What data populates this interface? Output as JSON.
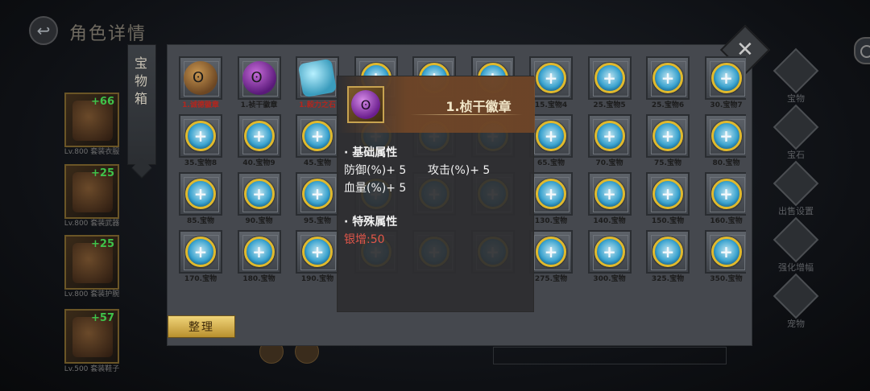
{
  "header": {
    "title": "角色详情"
  },
  "equipment": [
    {
      "plus": "+66",
      "caption": "Lv.800 套装衣服"
    },
    {
      "plus": "+25",
      "caption": "Lv.800 套装武器"
    },
    {
      "plus": "+25",
      "caption": "Lv.800 套装护腕"
    },
    {
      "plus": "+57",
      "caption": "Lv.500 套装鞋子"
    }
  ],
  "side_menu": [
    {
      "label": "宝物"
    },
    {
      "label": "宝石"
    },
    {
      "label": "出售设置"
    },
    {
      "label": "强化增幅"
    },
    {
      "label": "宠物"
    }
  ],
  "treasure_box": {
    "tab_label": "宝物箱",
    "sort_label": "整理",
    "slots": [
      {
        "caption": "1.诚德徽章",
        "kind": "brown",
        "sym": "ʘ",
        "red": true
      },
      {
        "caption": "1.祯干徽章",
        "kind": "purple",
        "sym": "ʘ",
        "red": false
      },
      {
        "caption": "1.毅力之石",
        "kind": "cyan",
        "sym": "",
        "red": true
      },
      {
        "caption": "",
        "kind": "coin"
      },
      {
        "caption": "",
        "kind": "coin"
      },
      {
        "caption": "",
        "kind": "coin"
      },
      {
        "caption": "15.宝物4",
        "kind": "coin"
      },
      {
        "caption": "25.宝物5",
        "kind": "coin"
      },
      {
        "caption": "25.宝物6",
        "kind": "coin"
      },
      {
        "caption": "30.宝物7",
        "kind": "coin"
      },
      {
        "caption": "35.宝物8",
        "kind": "coin"
      },
      {
        "caption": "40.宝物9",
        "kind": "coin"
      },
      {
        "caption": "45.宝物",
        "kind": "coin"
      },
      {
        "caption": "",
        "kind": "coin"
      },
      {
        "caption": "",
        "kind": "coin"
      },
      {
        "caption": "",
        "kind": "coin"
      },
      {
        "caption": "65.宝物",
        "kind": "coin"
      },
      {
        "caption": "70.宝物",
        "kind": "coin"
      },
      {
        "caption": "75.宝物",
        "kind": "coin"
      },
      {
        "caption": "80.宝物",
        "kind": "coin"
      },
      {
        "caption": "85.宝物",
        "kind": "coin"
      },
      {
        "caption": "90.宝物",
        "kind": "coin"
      },
      {
        "caption": "95.宝物",
        "kind": "coin"
      },
      {
        "caption": "",
        "kind": "coin"
      },
      {
        "caption": "",
        "kind": "coin"
      },
      {
        "caption": "",
        "kind": "coin"
      },
      {
        "caption": "130.宝物",
        "kind": "coin"
      },
      {
        "caption": "140.宝物",
        "kind": "coin"
      },
      {
        "caption": "150.宝物",
        "kind": "coin"
      },
      {
        "caption": "160.宝物",
        "kind": "coin"
      },
      {
        "caption": "170.宝物",
        "kind": "coin"
      },
      {
        "caption": "180.宝物",
        "kind": "coin"
      },
      {
        "caption": "190.宝物",
        "kind": "coin"
      },
      {
        "caption": "",
        "kind": "coin"
      },
      {
        "caption": "",
        "kind": "coin"
      },
      {
        "caption": "",
        "kind": "coin"
      },
      {
        "caption": "275.宝物",
        "kind": "coin"
      },
      {
        "caption": "300.宝物",
        "kind": "coin"
      },
      {
        "caption": "325.宝物",
        "kind": "coin"
      },
      {
        "caption": "350.宝物",
        "kind": "coin"
      }
    ]
  },
  "tooltip": {
    "title": "1.桢干徽章",
    "base_title": "· 基础属性",
    "stat1": "防御(%)+ 5",
    "stat2": "攻击(%)+ 5",
    "stat3": "血量(%)+ 5",
    "special_title": "· 特殊属性",
    "special": "银增:50"
  },
  "icons": {
    "back": "back-arrow-icon",
    "close": "close-icon",
    "plus_slot": "plus-icon"
  }
}
